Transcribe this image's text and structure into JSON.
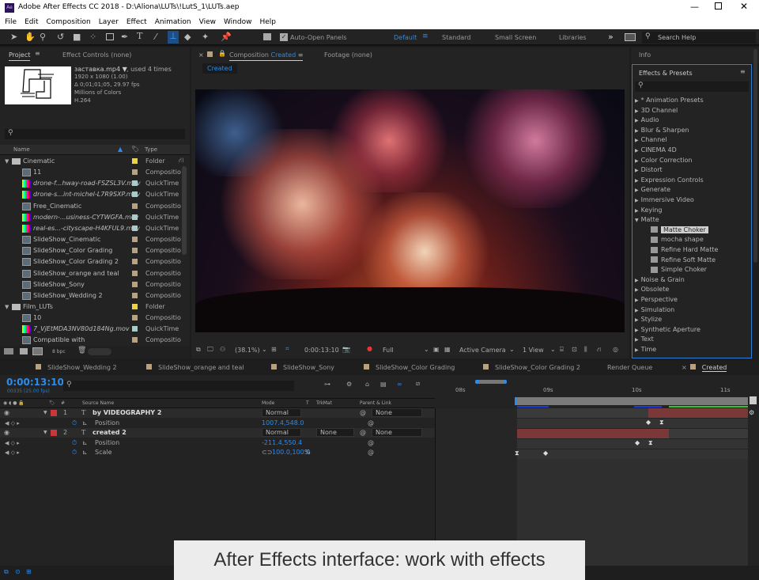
{
  "window": {
    "title": "Adobe After Effects CC 2018 - D:\\Aliona\\LUTs\\!LutS_1\\LUTs.aep",
    "app_icon": "Ae"
  },
  "menu": [
    "File",
    "Edit",
    "Composition",
    "Layer",
    "Effect",
    "Animation",
    "View",
    "Window",
    "Help"
  ],
  "toolbar": {
    "auto_open": "Auto-Open Panels",
    "workspaces": [
      "Default",
      "Standard",
      "Small Screen",
      "Libraries"
    ],
    "search_help": "Search Help",
    "overflow": "»"
  },
  "project": {
    "tab": "Project",
    "effect_controls": "Effect Controls (none)",
    "footage": {
      "name": "заставка.mp4 ▼",
      "used": ", used 4 times",
      "dims": "1920 x 1080 (1.00)",
      "duration": "Δ 0;01;01;05, 29.97 fps",
      "colors": "Millions of Colors",
      "codec": "H.264"
    },
    "columns": {
      "name": "Name",
      "type": "Type"
    },
    "items": [
      {
        "name": "Cinematic",
        "type": "Folder",
        "kind": "folder",
        "color": "#e8d34a",
        "indent": 0
      },
      {
        "name": "11",
        "type": "Compositio",
        "kind": "comp",
        "color": "#b9a17e",
        "indent": 1
      },
      {
        "name": "drone-f...hway-road-FSZSL3V.mov",
        "type": "QuickTime",
        "kind": "movie",
        "color": "#a6cdcc",
        "indent": 1
      },
      {
        "name": "drone-s...int-michel-L7R9SXP.mov",
        "type": "QuickTime",
        "kind": "movie",
        "color": "#a6cdcc",
        "indent": 1
      },
      {
        "name": "Free_Cinematic",
        "type": "Compositio",
        "kind": "comp",
        "color": "#b9a17e",
        "indent": 1
      },
      {
        "name": "modern-...usiness-CYTWGFA.mov",
        "type": "QuickTime",
        "kind": "movie",
        "color": "#a6cdcc",
        "indent": 1
      },
      {
        "name": "real-es...-cityscape-H4KFUL9.mov",
        "type": "QuickTime",
        "kind": "movie",
        "color": "#a6cdcc",
        "indent": 1
      },
      {
        "name": "SlideShow_Cinematic",
        "type": "Compositio",
        "kind": "comp",
        "color": "#b9a17e",
        "indent": 1
      },
      {
        "name": "SlideShow_Color Grading",
        "type": "Compositio",
        "kind": "comp",
        "color": "#b9a17e",
        "indent": 1
      },
      {
        "name": "SlideShow_Color Grading 2",
        "type": "Compositio",
        "kind": "comp",
        "color": "#b9a17e",
        "indent": 1
      },
      {
        "name": "SlideShow_orange and teal",
        "type": "Compositio",
        "kind": "comp",
        "color": "#b9a17e",
        "indent": 1
      },
      {
        "name": "SlideShow_Sony",
        "type": "Compositio",
        "kind": "comp",
        "color": "#b9a17e",
        "indent": 1
      },
      {
        "name": "SlideShow_Wedding 2",
        "type": "Compositio",
        "kind": "comp",
        "color": "#b9a17e",
        "indent": 1
      },
      {
        "name": "Film_LUTs",
        "type": "Folder",
        "kind": "folder",
        "color": "#e8d34a",
        "indent": 0
      },
      {
        "name": "10",
        "type": "Compositio",
        "kind": "comp",
        "color": "#b9a17e",
        "indent": 1
      },
      {
        "name": "7_VjEtMDA3NV80d184Ng.mov",
        "type": "QuickTime",
        "kind": "movie",
        "color": "#a6cdcc",
        "indent": 1
      },
      {
        "name": "Compatible with",
        "type": "Compositio",
        "kind": "comp",
        "color": "#b9a17e",
        "indent": 1
      }
    ],
    "bpc": "8 bpc"
  },
  "viewer": {
    "tab_prefix": "Composition",
    "tab_name": "Created",
    "footage_tab": "Footage (none)",
    "subtab": "Created",
    "zoom": "(38.1%)",
    "timecode": "0:00:13:10",
    "resolution": "Full",
    "camera": "Active Camera",
    "views": "1 View"
  },
  "right": {
    "info": "Info",
    "effects_title": "Effects & Presets",
    "effects": [
      {
        "label": "* Animation Presets",
        "open": false,
        "child": false
      },
      {
        "label": "3D Channel",
        "open": false,
        "child": false
      },
      {
        "label": "Audio",
        "open": false,
        "child": false
      },
      {
        "label": "Blur & Sharpen",
        "open": false,
        "child": false
      },
      {
        "label": "Channel",
        "open": false,
        "child": false
      },
      {
        "label": "CINEMA 4D",
        "open": false,
        "child": false
      },
      {
        "label": "Color Correction",
        "open": false,
        "child": false
      },
      {
        "label": "Distort",
        "open": false,
        "child": false
      },
      {
        "label": "Expression Controls",
        "open": false,
        "child": false
      },
      {
        "label": "Generate",
        "open": false,
        "child": false
      },
      {
        "label": "Immersive Video",
        "open": false,
        "child": false
      },
      {
        "label": "Keying",
        "open": false,
        "child": false
      },
      {
        "label": "Matte",
        "open": true,
        "child": false
      },
      {
        "label": "Matte Choker",
        "child": true,
        "selected": true
      },
      {
        "label": "mocha shape",
        "child": true
      },
      {
        "label": "Refine Hard Matte",
        "child": true
      },
      {
        "label": "Refine Soft Matte",
        "child": true
      },
      {
        "label": "Simple Choker",
        "child": true
      },
      {
        "label": "Noise & Grain",
        "open": false,
        "child": false
      },
      {
        "label": "Obsolete",
        "open": false,
        "child": false
      },
      {
        "label": "Perspective",
        "open": false,
        "child": false
      },
      {
        "label": "Simulation",
        "open": false,
        "child": false
      },
      {
        "label": "Stylize",
        "open": false,
        "child": false
      },
      {
        "label": "Synthetic Aperture",
        "open": false,
        "child": false
      },
      {
        "label": "Text",
        "open": false,
        "child": false
      },
      {
        "label": "Time",
        "open": false,
        "child": false
      }
    ]
  },
  "timeline": {
    "tabs": [
      "SlideShow_Wedding 2",
      "SlideShow_orange and teal",
      "SlideShow_Sony",
      "SlideShow_Color Grading",
      "SlideShow_Color Grading 2",
      "Render Queue",
      "Created"
    ],
    "timecode": "0:00:13:10",
    "frames": "00335 (25.00 fps)",
    "columns": {
      "num": "#",
      "source": "Source Name",
      "mode": "Mode",
      "t": "T",
      "trkmat": "TrkMat",
      "parent": "Parent & Link"
    },
    "ruler": [
      "08s",
      "09s",
      "10s",
      "11s"
    ],
    "layers": [
      {
        "num": "1",
        "name": "by VIDEOGRAPHY 2",
        "mode": "Normal",
        "trkmat": "",
        "parent": "None",
        "props": [
          {
            "name": "Position",
            "value": "1007.4,548.0"
          }
        ]
      },
      {
        "num": "2",
        "name": "created 2",
        "mode": "Normal",
        "trkmat": "None",
        "parent": "None",
        "props": [
          {
            "name": "Position",
            "value": "-211.4,550.4"
          },
          {
            "name": "Scale",
            "value": "100.0,100.0",
            "unit": "%"
          }
        ]
      }
    ]
  },
  "caption": "After Effects interface: work with effects",
  "colors": {
    "accent": "#2d8ceb",
    "label_red": "#c9373a",
    "bar_red": "#7a3838"
  }
}
